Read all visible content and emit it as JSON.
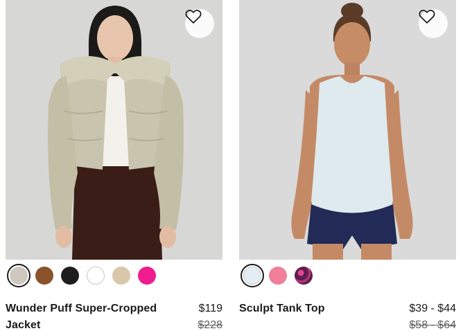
{
  "products": [
    {
      "name": "Wunder Puff Super-Cropped Jacket",
      "price": "$119",
      "original_price": "$228",
      "wishlist_icon": "heart-outline-icon",
      "swatches": [
        {
          "color": "#cfc8bf",
          "selected": true
        },
        {
          "color": "#8a532c",
          "selected": false
        },
        {
          "color": "#1d1d1d",
          "selected": false
        },
        {
          "color": "#ffffff",
          "selected": false
        },
        {
          "color": "#d8c7a8",
          "selected": false
        },
        {
          "color": "#ef1c8f",
          "selected": false
        }
      ]
    },
    {
      "name": "Sculpt Tank Top",
      "price": "$39 - $44",
      "original_price": "$58 - $64",
      "wishlist_icon": "heart-outline-icon",
      "swatches": [
        {
          "color": "#e3edf3",
          "selected": true
        },
        {
          "color": "#f07f99",
          "selected": false
        },
        {
          "color": "#5a1f4e",
          "selected": false
        }
      ]
    }
  ]
}
